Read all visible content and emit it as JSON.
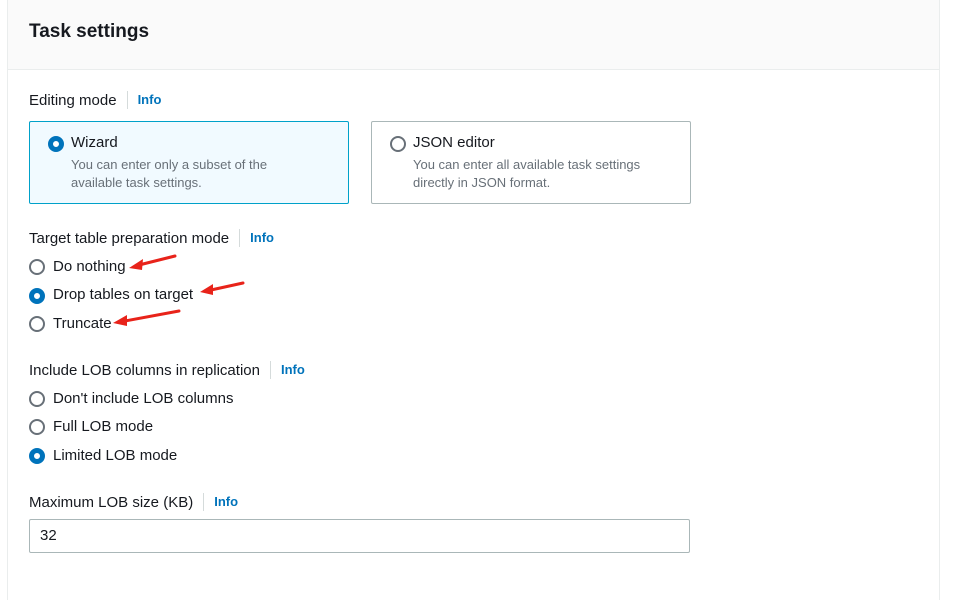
{
  "panel": {
    "title": "Task settings"
  },
  "editing_mode": {
    "label": "Editing mode",
    "info": "Info",
    "options": [
      {
        "title": "Wizard",
        "desc_line1": "You can enter only a subset of the",
        "desc_line2": "available task settings.",
        "selected": true
      },
      {
        "title": "JSON editor",
        "desc_line1": "You can enter all available task settings",
        "desc_line2": "directly in JSON format.",
        "selected": false
      }
    ]
  },
  "target_prep": {
    "label": "Target table preparation mode",
    "info": "Info",
    "options": [
      {
        "label": "Do nothing",
        "selected": false
      },
      {
        "label": "Drop tables on target",
        "selected": true
      },
      {
        "label": "Truncate",
        "selected": false
      }
    ]
  },
  "lob": {
    "label": "Include LOB columns in replication",
    "info": "Info",
    "options": [
      {
        "label": "Don't include LOB columns",
        "selected": false
      },
      {
        "label": "Full LOB mode",
        "selected": false
      },
      {
        "label": "Limited LOB mode",
        "selected": true
      }
    ]
  },
  "max_lob": {
    "label": "Maximum LOB size (KB)",
    "info": "Info",
    "value": "32"
  },
  "colors": {
    "accent": "#0073bb",
    "annotation": "#e8231a",
    "selected_border": "#00a1c9"
  }
}
